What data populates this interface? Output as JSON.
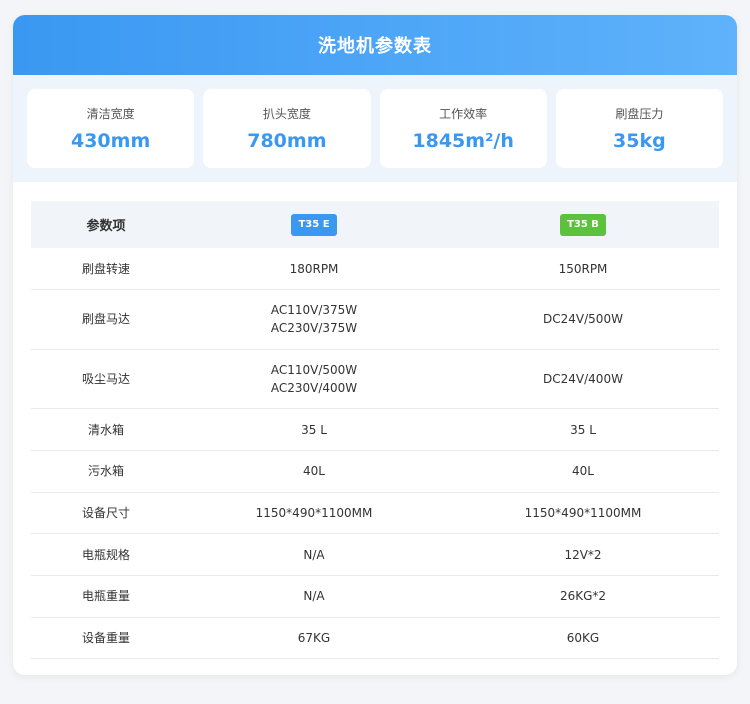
{
  "header": {
    "title": "洗地机参数表"
  },
  "stats": [
    {
      "label": "清洁宽度",
      "value": "430mm"
    },
    {
      "label": "扒头宽度",
      "value": "780mm"
    },
    {
      "label": "工作效率",
      "value": "1845m²/h"
    },
    {
      "label": "刷盘压力",
      "value": "35kg"
    }
  ],
  "colors": {
    "accent": "#3a98f2",
    "badge_e": "#3a98f2",
    "badge_b": "#5cc13c"
  },
  "table": {
    "headers": {
      "param": "参数项",
      "model_a": "T35 E",
      "model_b": "T35 B"
    },
    "rows": [
      {
        "name": "刷盘转速",
        "a": [
          "180RPM"
        ],
        "b": [
          "150RPM"
        ]
      },
      {
        "name": "刷盘马达",
        "a": [
          "AC110V/375W",
          "AC230V/375W"
        ],
        "b": [
          "DC24V/500W"
        ]
      },
      {
        "name": "吸尘马达",
        "a": [
          "AC110V/500W",
          "AC230V/400W"
        ],
        "b": [
          "DC24V/400W"
        ]
      },
      {
        "name": "清水箱",
        "a": [
          "35 L"
        ],
        "b": [
          "35 L"
        ]
      },
      {
        "name": "污水箱",
        "a": [
          "40L"
        ],
        "b": [
          "40L"
        ]
      },
      {
        "name": "设备尺寸",
        "a": [
          "1150*490*1100MM"
        ],
        "b": [
          "1150*490*1100MM"
        ]
      },
      {
        "name": "电瓶规格",
        "a": [
          "N/A"
        ],
        "b": [
          "12V*2"
        ]
      },
      {
        "name": "电瓶重量",
        "a": [
          "N/A"
        ],
        "b": [
          "26KG*2"
        ]
      },
      {
        "name": "设备重量",
        "a": [
          "67KG"
        ],
        "b": [
          "60KG"
        ]
      }
    ]
  }
}
